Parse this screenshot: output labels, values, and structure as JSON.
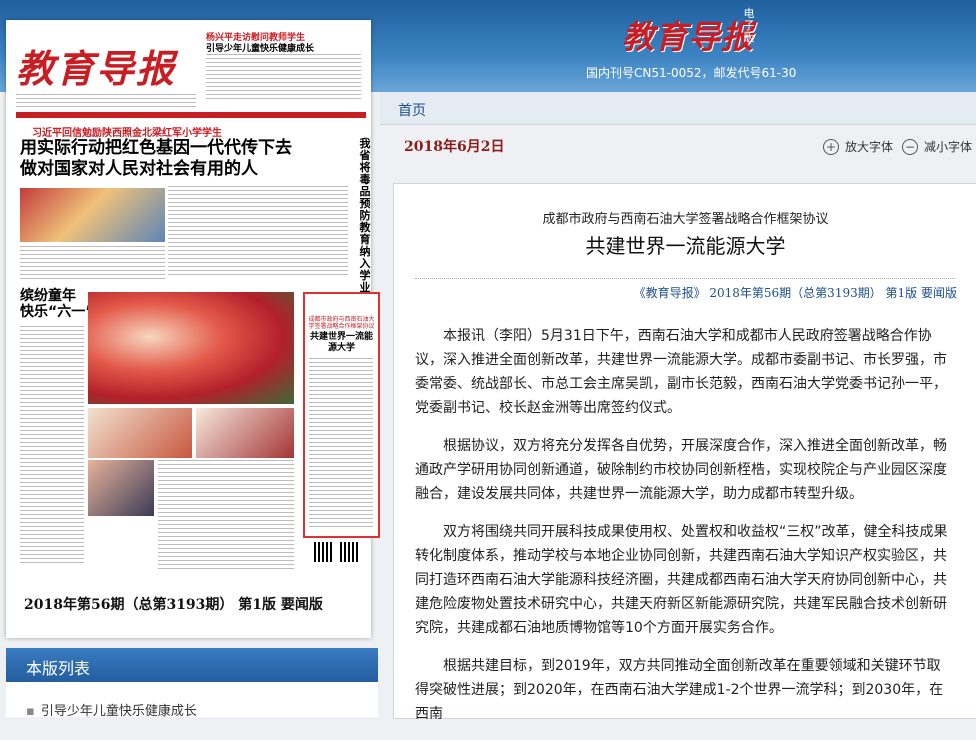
{
  "header": {
    "logo": "教育导报",
    "edition": "电子版",
    "issn": "国内刊号CN51-0052，邮发代号61-30"
  },
  "nav": {
    "home": "首页"
  },
  "newspaper": {
    "logo": "教育导报",
    "top_red": "杨兴平走访慰问教师学生",
    "top_black": "引导少年儿童快乐健康成长",
    "sub_red": "习近平回信勉励陕西照金北梁红军小学学生",
    "headline_line1": "用实际行动把红色基因一代代传下去",
    "headline_line2": "做对国家对人民对社会有用的人",
    "vertical": "我省将毒品预防教育纳入学业水平考试",
    "section_title_line1": "缤纷童年",
    "section_title_line2": "快乐“六一”",
    "highlight_small": "成都市政府与西南石油大学签署战略合作框架协议",
    "highlight_title": "共建世界一流能源大学",
    "caption": "2018年第56期（总第3193期） 第1版  要闻版"
  },
  "page_list": {
    "title": "本版列表",
    "items": [
      "引导少年儿童快乐健康成长"
    ]
  },
  "date": "2018年6月2日",
  "font_controls": {
    "enlarge": "放大字体",
    "shrink": "减小字体"
  },
  "article": {
    "kicker": "成都市政府与西南石油大学签署战略合作框架协议",
    "title": "共建世界一流能源大学",
    "meta": "《教育导报》 2018年第56期（总第3193期） 第1版 要闻版",
    "paragraphs": [
      "本报讯（李阳）5月31日下午，西南石油大学和成都市人民政府签署战略合作协议，深入推进全面创新改革，共建世界一流能源大学。成都市委副书记、市长罗强，市委常委、统战部长、市总工会主席吴凯，副市长范毅，西南石油大学党委书记孙一平，党委副书记、校长赵金洲等出席签约仪式。",
      "根据协议，双方将充分发挥各自优势，开展深度合作，深入推进全面创新改革，畅通政产学研用协同创新通道，破除制约市校协同创新桎梏，实现校院企与产业园区深度融合，建设发展共同体，共建世界一流能源大学，助力成都市转型升级。",
      "双方将围绕共同开展科技成果使用权、处置权和收益权“三权”改革，健全科技成果转化制度体系，推动学校与本地企业协同创新，共建西南石油大学知识产权实验区，共同打造环西南石油大学能源科技经济圈，共建成都西南石油大学天府协同创新中心，共建危险废物处置技术研究中心，共建天府新区新能源研究院，共建军民融合技术创新研究院，共建成都石油地质博物馆等10个方面开展实务合作。",
      "根据共建目标，到2019年，双方共同推动全面创新改革在重要领域和关键环节取得突破性进展；到2020年，在西南石油大学建成1-2个世界一流学科；到2030年，在西南"
    ]
  }
}
